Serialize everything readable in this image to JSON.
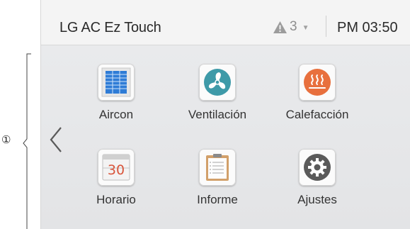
{
  "callout": {
    "marker": "①"
  },
  "header": {
    "title": "LG AC Ez Touch",
    "alert_count": "3",
    "time": "PM 03:50"
  },
  "menu": {
    "items": [
      {
        "label": "Aircon",
        "icon": "aircon-icon"
      },
      {
        "label": "Ventilación",
        "icon": "ventilation-fan-icon"
      },
      {
        "label": "Calefacción",
        "icon": "heating-icon"
      },
      {
        "label": "Horario",
        "icon": "calendar-icon"
      },
      {
        "label": "Informe",
        "icon": "clipboard-report-icon"
      },
      {
        "label": "Ajustes",
        "icon": "settings-gear-icon"
      }
    ]
  },
  "colors": {
    "fan_teal": "#3e9aa8",
    "heating_orange": "#e8703e",
    "aircon_blue": "#2f7cd6",
    "calendar_red": "#d9553b",
    "clipboard_tan": "#d2a06a",
    "gear_dark": "#5a5a5a"
  }
}
